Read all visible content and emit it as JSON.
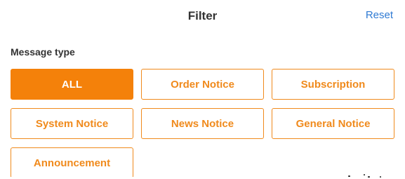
{
  "header": {
    "title": "Filter",
    "reset_label": "Reset"
  },
  "section": {
    "label": "Message type"
  },
  "options": [
    {
      "label": "ALL",
      "selected": true
    },
    {
      "label": "Order Notice",
      "selected": false
    },
    {
      "label": "Subscription",
      "selected": false
    },
    {
      "label": "System Notice",
      "selected": false
    },
    {
      "label": "News Notice",
      "selected": false
    },
    {
      "label": "General Notice",
      "selected": false
    },
    {
      "label": "Announcement",
      "selected": false
    }
  ],
  "colors": {
    "accent": "#f4810a",
    "link": "#2f7ad3",
    "text": "#333333"
  }
}
